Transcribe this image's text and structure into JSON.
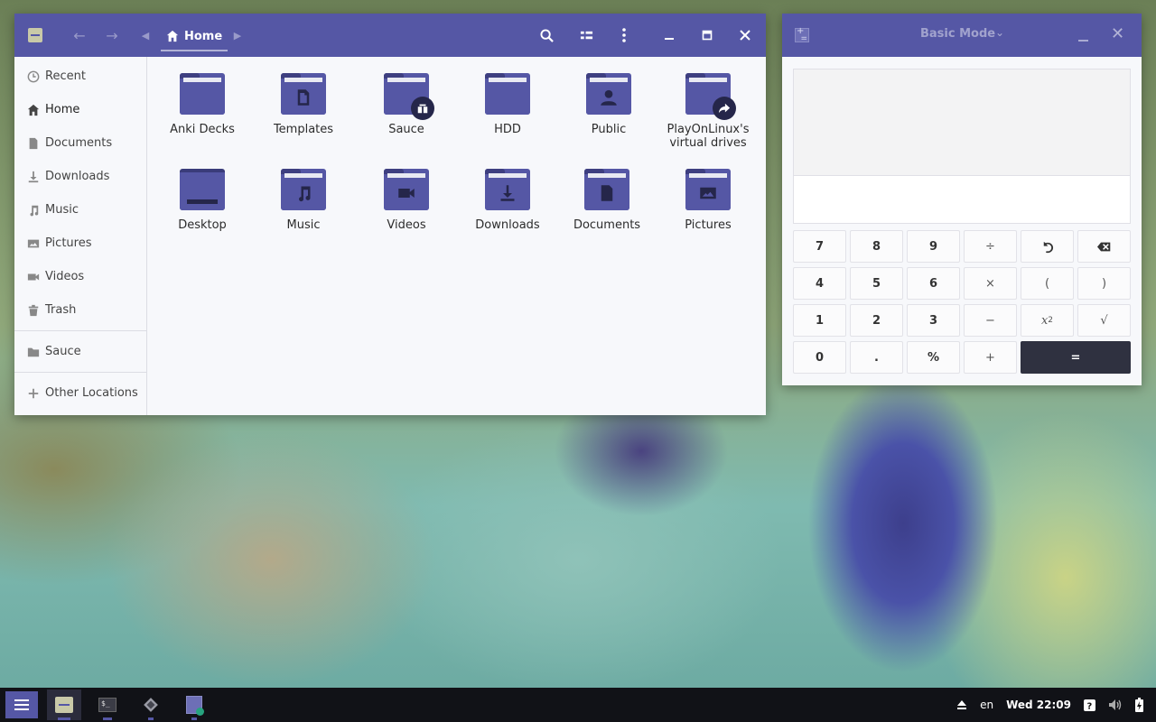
{
  "file_manager": {
    "breadcrumb": "Home",
    "sidebar": [
      {
        "label": "Recent",
        "icon": "clock-icon"
      },
      {
        "label": "Home",
        "icon": "home-icon"
      },
      {
        "label": "Documents",
        "icon": "document-icon"
      },
      {
        "label": "Downloads",
        "icon": "download-icon"
      },
      {
        "label": "Music",
        "icon": "music-icon"
      },
      {
        "label": "Pictures",
        "icon": "picture-icon"
      },
      {
        "label": "Videos",
        "icon": "video-icon"
      },
      {
        "label": "Trash",
        "icon": "trash-icon"
      },
      {
        "label": "Sauce",
        "icon": "folder-icon"
      },
      {
        "label": "Other Locations",
        "icon": "plus-icon"
      }
    ],
    "items": [
      {
        "label": "Anki Decks",
        "icon": "folder-icon"
      },
      {
        "label": "Templates",
        "icon": "templates-folder-icon"
      },
      {
        "label": "Sauce",
        "icon": "shared-folder-icon"
      },
      {
        "label": "HDD",
        "icon": "folder-icon"
      },
      {
        "label": "Public",
        "icon": "public-folder-icon"
      },
      {
        "label": "PlayOnLinux's virtual drives",
        "icon": "symlink-folder-icon"
      },
      {
        "label": "Desktop",
        "icon": "desktop-folder-icon"
      },
      {
        "label": "Music",
        "icon": "music-folder-icon"
      },
      {
        "label": "Videos",
        "icon": "videos-folder-icon"
      },
      {
        "label": "Downloads",
        "icon": "downloads-folder-icon"
      },
      {
        "label": "Documents",
        "icon": "documents-folder-icon"
      },
      {
        "label": "Pictures",
        "icon": "pictures-folder-icon"
      }
    ]
  },
  "calculator": {
    "mode": "Basic Mode",
    "keys": {
      "k7": "7",
      "k8": "8",
      "k9": "9",
      "div": "÷",
      "k4": "4",
      "k5": "5",
      "k6": "6",
      "mul": "×",
      "lparen": "(",
      "rparen": ")",
      "k1": "1",
      "k2": "2",
      "k3": "3",
      "sub": "−",
      "sqrt": "√",
      "k0": "0",
      "dot": ".",
      "pct": "%",
      "add": "+",
      "eq": "="
    }
  },
  "taskbar": {
    "language": "en",
    "clock": "Wed 22:09"
  },
  "colors": {
    "accent": "#5557a5",
    "dark": "#2f3140"
  }
}
